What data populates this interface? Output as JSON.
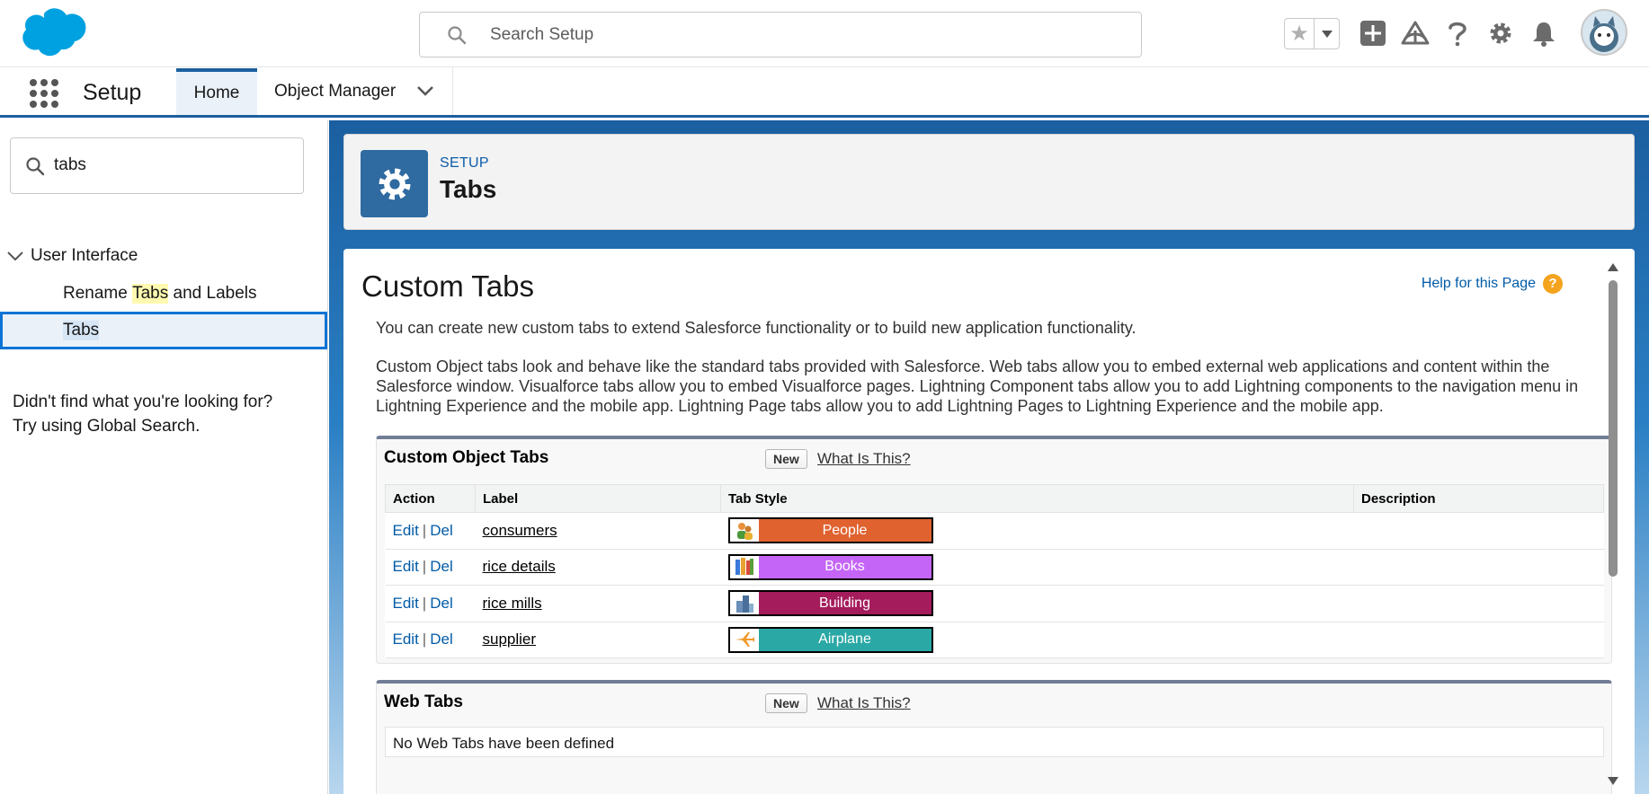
{
  "header": {
    "search_placeholder": "Search Setup",
    "icons": [
      "salesforce-cloud-logo",
      "star-icon",
      "chevron-down-icon",
      "add-icon",
      "trailhead-icon",
      "help-icon",
      "gear-icon",
      "bell-icon",
      "avatar"
    ]
  },
  "nav": {
    "app_name": "Setup",
    "tabs": [
      {
        "label": "Home"
      },
      {
        "label": "Object Manager"
      }
    ]
  },
  "sidebar": {
    "search_value": "tabs",
    "section": "User Interface",
    "items": [
      {
        "prefix": "Rename ",
        "highlight": "Tabs",
        "suffix": " and Labels"
      },
      {
        "prefix": "",
        "highlight": "Tabs",
        "suffix": ""
      }
    ],
    "not_found_line1": "Didn't find what you're looking for?",
    "not_found_line2": "Try using Global Search."
  },
  "page": {
    "eyebrow": "SETUP",
    "title": "Tabs"
  },
  "content": {
    "title": "Custom Tabs",
    "help_link": "Help for this Page",
    "help_q": "?",
    "para1": "You can create new custom tabs to extend Salesforce functionality or to build new application functionality.",
    "para2": "Custom Object tabs look and behave like the standard tabs provided with Salesforce. Web tabs allow you to embed external web applications and content within the Salesforce window. Visualforce tabs allow you to embed Visualforce pages. Lightning Component tabs allow you to add Lightning components to the navigation menu in Lightning Experience and the mobile app. Lightning Page tabs allow you to add Lightning Pages to Lightning Experience and the mobile app."
  },
  "custom_object_tabs": {
    "title": "Custom Object Tabs",
    "new_label": "New",
    "what_label": "What Is This?",
    "columns": [
      "Action",
      "Label",
      "Tab Style",
      "Description"
    ],
    "edit_label": "Edit",
    "del_label": "Del",
    "sep": "|",
    "rows": [
      {
        "label": "consumers",
        "style": "People",
        "color": "#e0622f",
        "icon": "people-icon",
        "description": ""
      },
      {
        "label": "rice details",
        "style": "Books",
        "color": "#c565f7",
        "icon": "books-icon",
        "description": ""
      },
      {
        "label": "rice mills",
        "style": "Building",
        "color": "#a51c5c",
        "icon": "building-icon",
        "description": ""
      },
      {
        "label": "supplier",
        "style": "Airplane",
        "color": "#2aa8a5",
        "icon": "airplane-icon",
        "description": ""
      }
    ]
  },
  "web_tabs": {
    "title": "Web Tabs",
    "new_label": "New",
    "what_label": "What Is This?",
    "empty_text": "No Web Tabs have been defined"
  }
}
